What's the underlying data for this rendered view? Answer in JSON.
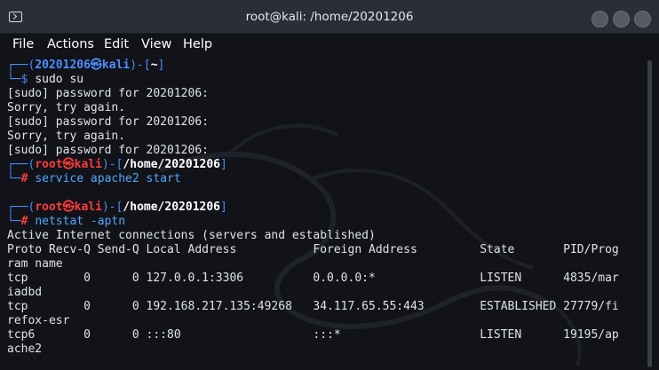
{
  "window": {
    "title": "root@kali: /home/20201206",
    "icon": "terminal-icon"
  },
  "menu": {
    "file": "File",
    "actions": "Actions",
    "edit": "Edit",
    "view": "View",
    "help": "Help"
  },
  "terminal": {
    "p1_open": "┌──(",
    "p1_user": "20201206㉿kali",
    "p1_mid": ")-[",
    "p1_dir": "~",
    "p1_close": "]",
    "p1_prompt": "└─$ ",
    "p1_cmd": "sudo su",
    "l_sudo1": "[sudo] password for 20201206:",
    "l_sorry1": "Sorry, try again.",
    "l_sudo2": "[sudo] password for 20201206:",
    "l_sorry2": "Sorry, try again.",
    "l_sudo3": "[sudo] password for 20201206:",
    "p2_open": "┌──(",
    "p2_user": "root㉿kali",
    "p2_mid": ")-[",
    "p2_dir": "/home/20201206",
    "p2_close": "]",
    "p2_prompt_bar": "└─",
    "p2_hash": "# ",
    "p2_cmd": "service apache2 start",
    "p3_open": "┌──(",
    "p3_user": "root㉿kali",
    "p3_mid": ")-[",
    "p3_dir": "/home/20201206",
    "p3_close": "]",
    "p3_prompt_bar": "└─",
    "p3_hash": "# ",
    "p3_cmd": "netstat -aptn",
    "ns_title": "Active Internet connections (servers and established)",
    "ns_header": "Proto Recv-Q Send-Q Local Address           Foreign Address         State       PID/Prog",
    "ns_header_wrap": "ram name",
    "ns_row1": "tcp        0      0 127.0.0.1:3306          0.0.0.0:*               LISTEN      4835/mar",
    "ns_row1_wrap": "iadbd",
    "ns_row2": "tcp        0      0 192.168.217.135:49268   34.117.65.55:443        ESTABLISHED 27779/fi",
    "ns_row2_wrap": "refox-esr",
    "ns_row3": "tcp6       0      0 :::80                   :::*                    LISTEN      19195/ap",
    "ns_row3_wrap": "ache2"
  },
  "colors": {
    "background": "#111318",
    "user_prompt": "#4f8dff",
    "root_prompt": "#ff3b3b",
    "command": "#52a8ff"
  }
}
